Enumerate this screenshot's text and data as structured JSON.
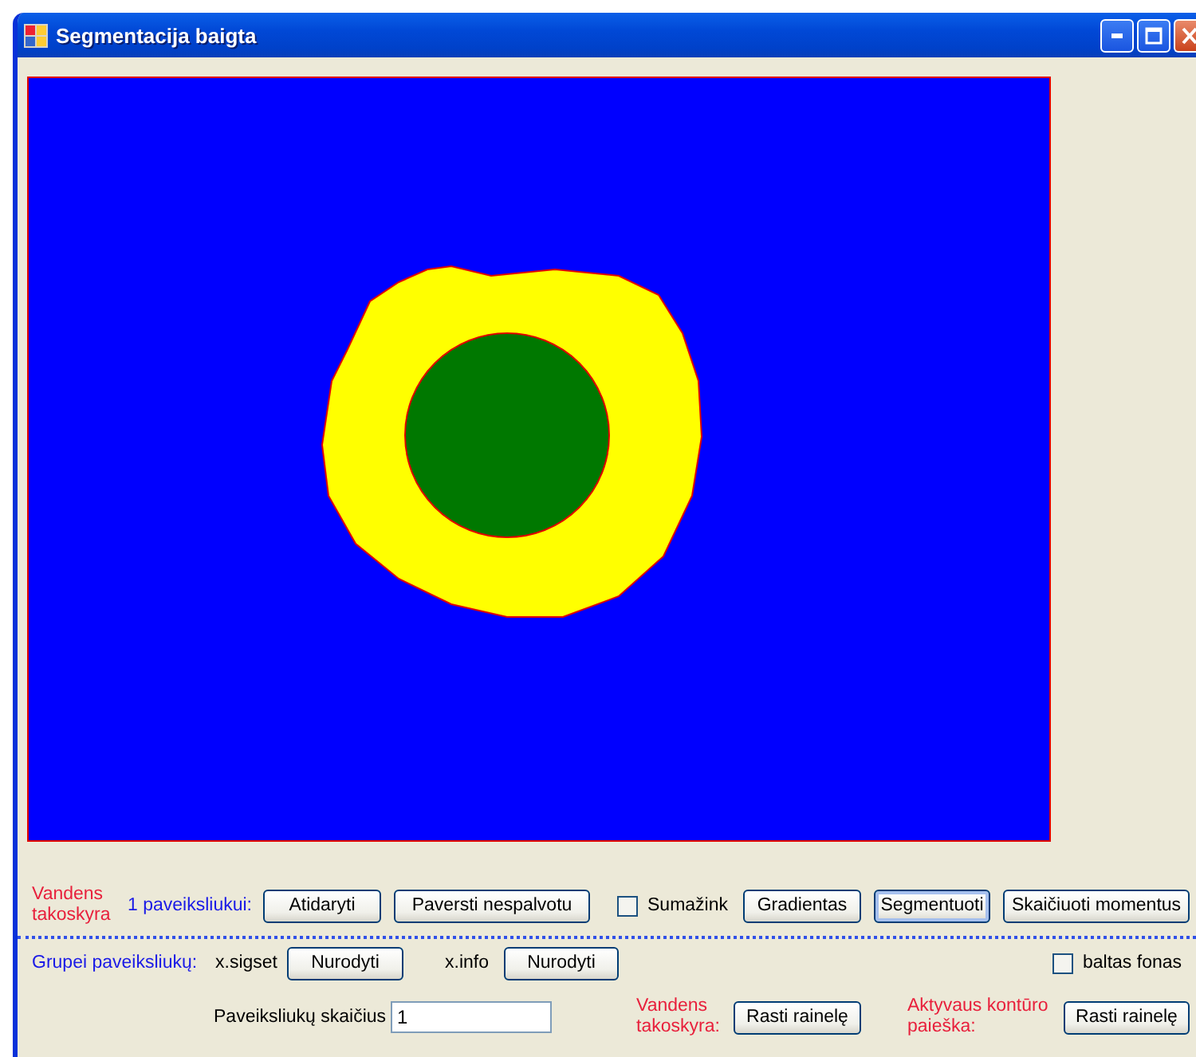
{
  "window": {
    "title": "Segmentacija baigta"
  },
  "rows": [
    {
      "items": [
        {
          "kind": "note",
          "text": "Vandens takoskyra"
        },
        {
          "kind": "group",
          "text": "1 paveiksliukui:"
        },
        {
          "kind": "button",
          "text": "Atidaryti",
          "focused": false
        },
        {
          "kind": "button",
          "text": "Paversti nespalvotu",
          "focused": false
        },
        {
          "kind": "checkbox",
          "text": "Sumažink",
          "checked": false
        },
        {
          "kind": "button",
          "text": "Gradientas",
          "focused": false
        },
        {
          "kind": "button",
          "text": "Segmentuoti",
          "focused": true
        },
        {
          "kind": "button",
          "text": "Skaičiuoti momentus",
          "focused": false
        }
      ]
    },
    {
      "items": [
        {
          "kind": "group",
          "text": "Grupei paveiksliukų:"
        },
        {
          "kind": "label",
          "text": "x.sigset"
        },
        {
          "kind": "button",
          "text": "Nurodyti",
          "focused": false
        },
        {
          "kind": "label",
          "text": "x.info"
        },
        {
          "kind": "button",
          "text": "Nurodyti",
          "focused": false
        },
        {
          "kind": "checkbox",
          "text": "baltas fonas",
          "checked": false
        }
      ]
    },
    {
      "items": [
        {
          "kind": "label",
          "text": "Paveiksliukų skaičius"
        },
        {
          "kind": "field",
          "value": "1"
        },
        {
          "kind": "note",
          "text": "Vandens takoskyra:"
        },
        {
          "kind": "button",
          "text": "Rasti rainelę",
          "focused": false
        },
        {
          "kind": "note",
          "text": "Aktyvaus kontūro paieška:"
        },
        {
          "kind": "button",
          "text": "Rasti rainelę",
          "focused": false
        }
      ]
    }
  ]
}
